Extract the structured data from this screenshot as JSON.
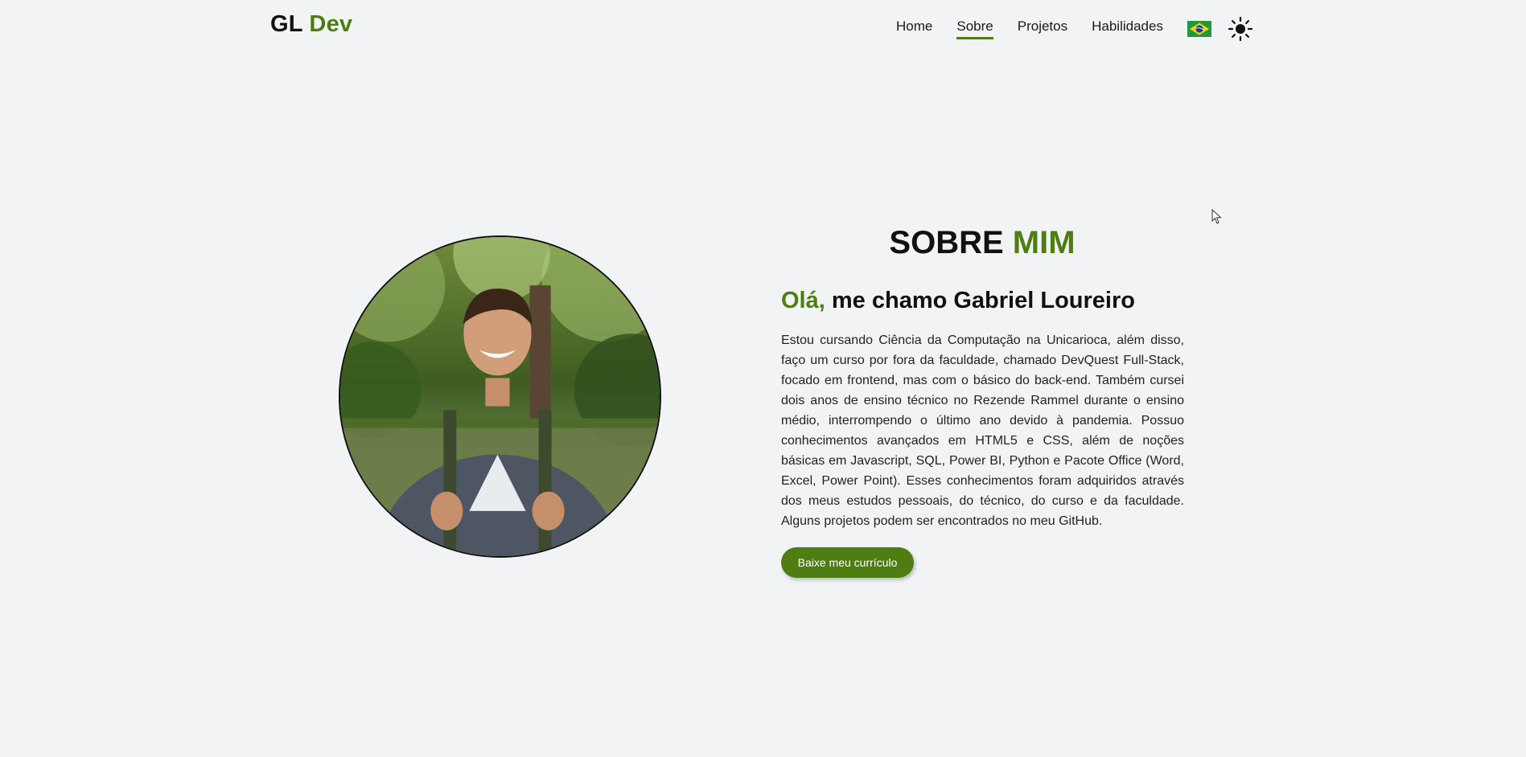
{
  "header": {
    "logo_main": "GL",
    "logo_accent": "Dev",
    "nav": [
      {
        "label": "Home"
      },
      {
        "label": "Sobre"
      },
      {
        "label": "Projetos"
      },
      {
        "label": "Habilidades"
      }
    ],
    "active_nav": "Sobre",
    "language_icon": "brazil-flag-icon",
    "theme_icon": "sun-icon"
  },
  "about": {
    "title_main": "SOBRE",
    "title_accent": "MIM",
    "greeting_accent": "Olá,",
    "greeting_rest": "me chamo Gabriel Loureiro",
    "bio": "Estou cursando Ciência da Computação na Unicarioca, além disso, faço um curso por fora da faculdade, chamado DevQuest Full-Stack, focado em frontend, mas com o básico do back-end. Também cursei dois anos de ensino técnico no Rezende Rammel durante o ensino médio, interrompendo o último ano devido à pandemia. Possuo conhecimentos avançados em HTML5 e CSS, além de noções básicas em Javascript, SQL, Power BI, Python e Pacote Office (Word, Excel, Power Point). Esses conhecimentos foram adquiridos através dos meus estudos pessoais, do técnico, do curso e da faculdade. Alguns projetos podem ser encontrados no meu GitHub.",
    "cv_button_label": "Baixe meu currículo"
  },
  "colors": {
    "accent": "#4e7d12",
    "background": "#f2f3f5",
    "text": "#111111"
  }
}
